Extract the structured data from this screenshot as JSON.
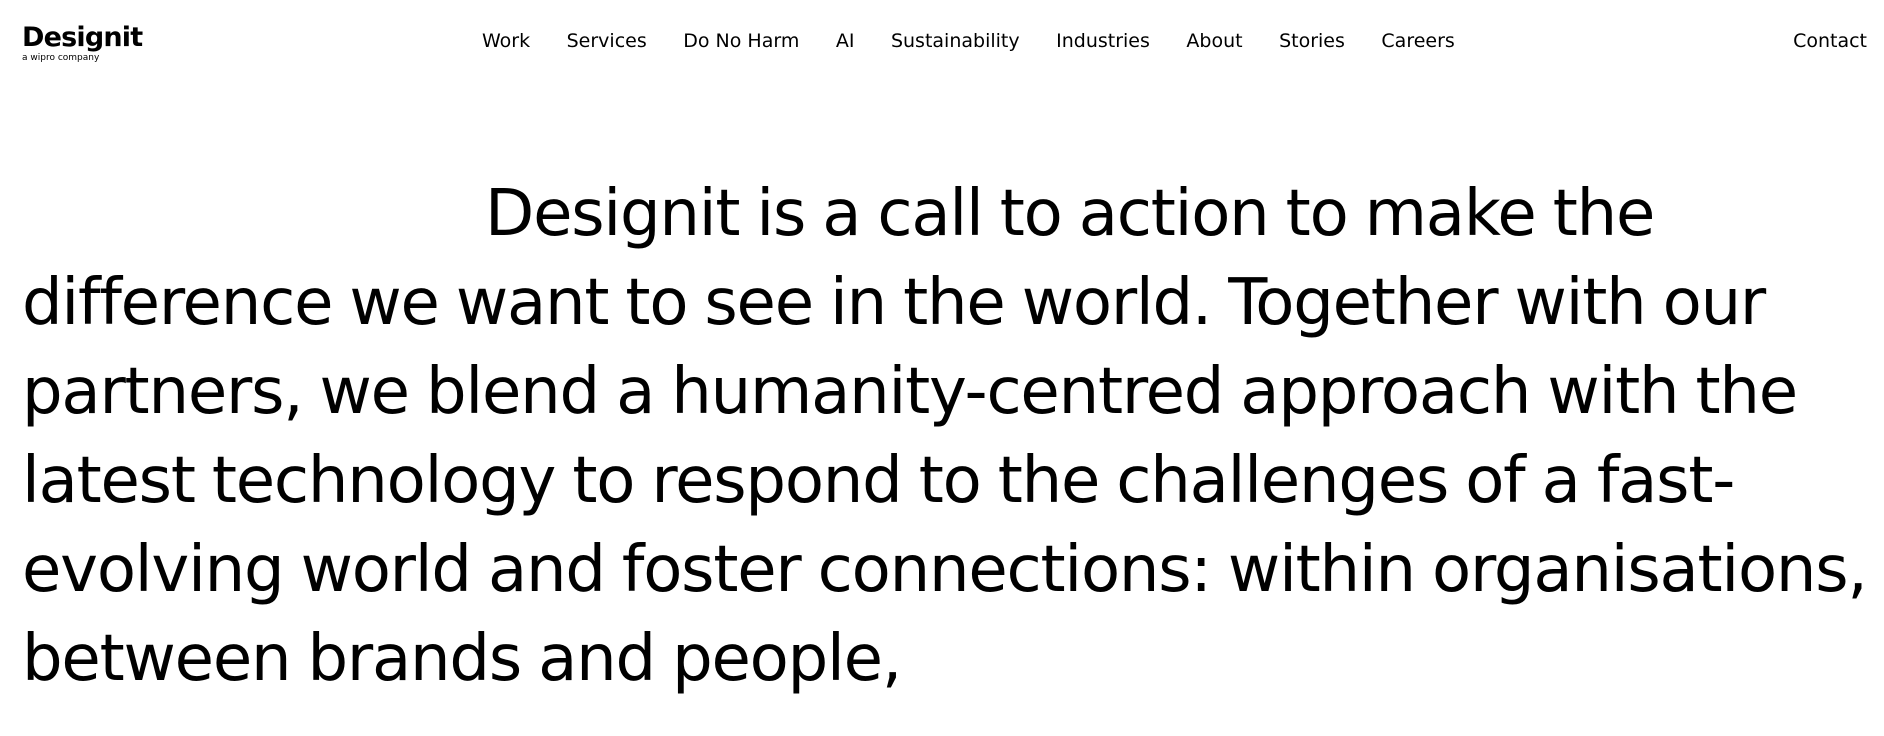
{
  "brand": {
    "name": "Designit",
    "tagline": "a wipro company"
  },
  "nav": {
    "items": [
      {
        "label": "Work"
      },
      {
        "label": "Services"
      },
      {
        "label": "Do No Harm"
      },
      {
        "label": "AI"
      },
      {
        "label": "Sustainability"
      },
      {
        "label": "Industries"
      },
      {
        "label": "About"
      },
      {
        "label": "Stories"
      },
      {
        "label": "Careers"
      }
    ],
    "contact": "Contact"
  },
  "hero": {
    "text": "Designit is a call to action to make the difference we want to see in the world. Together with our partners, we blend a humanity-centred approach with the latest technology to respond to the challenges of a fast-evolving world and foster connections: within organisations, between brands and people,"
  }
}
